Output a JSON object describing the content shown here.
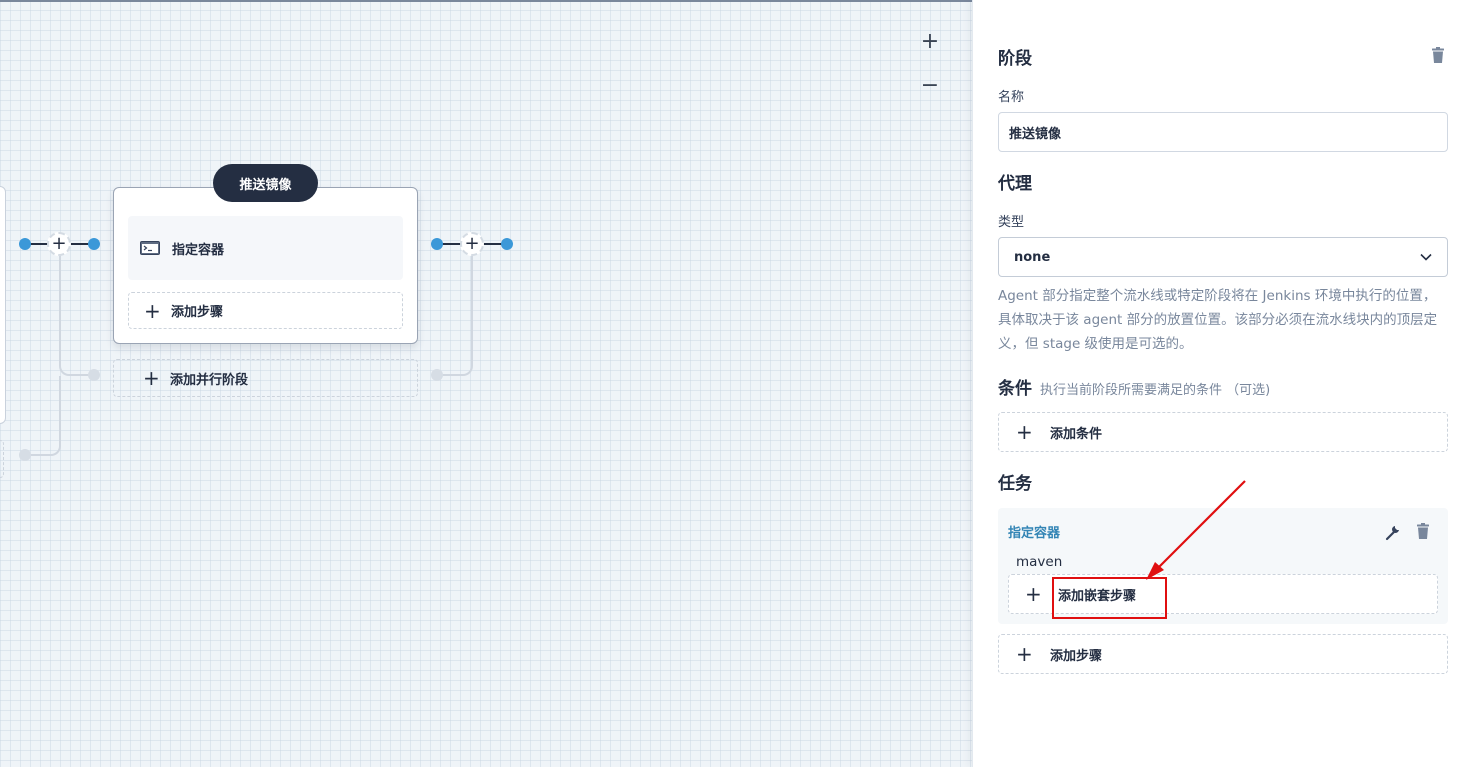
{
  "canvas": {
    "zoom_in": "+",
    "zoom_out": "−",
    "stage": {
      "title": "推送镜像",
      "step_label": "指定容器",
      "add_step_label": "添加步骤"
    },
    "add_parallel_label": "添加并行阶段",
    "node_plus": "+"
  },
  "panel": {
    "stage_heading": "阶段",
    "name_label": "名称",
    "name_value": "推送镜像",
    "agent_heading": "代理",
    "type_label": "类型",
    "type_value": "none",
    "agent_description": "Agent 部分指定整个流水线或特定阶段将在 Jenkins 环境中执行的位置， 具体取决于该 agent 部分的放置位置。该部分必须在流水线块内的顶层定义，但 stage 级使用是可选的。",
    "conditions_heading": "条件",
    "conditions_hint": "执行当前阶段所需要满足的条件 （可选)",
    "add_condition_label": "添加条件",
    "tasks_heading": "任务",
    "task": {
      "name": "指定容器",
      "value": "maven",
      "add_nested_step_label": "添加嵌套步骤"
    },
    "add_step_label": "添加步骤",
    "plus": "+"
  },
  "colors": {
    "accent_blue": "#3b98d8",
    "dark": "#242e42",
    "link_blue": "#3385b5",
    "annotation_red": "#e00f10"
  },
  "icons": [
    "terminal-icon",
    "trash-icon",
    "wrench-icon",
    "chevron-down-icon",
    "plus-icon"
  ]
}
